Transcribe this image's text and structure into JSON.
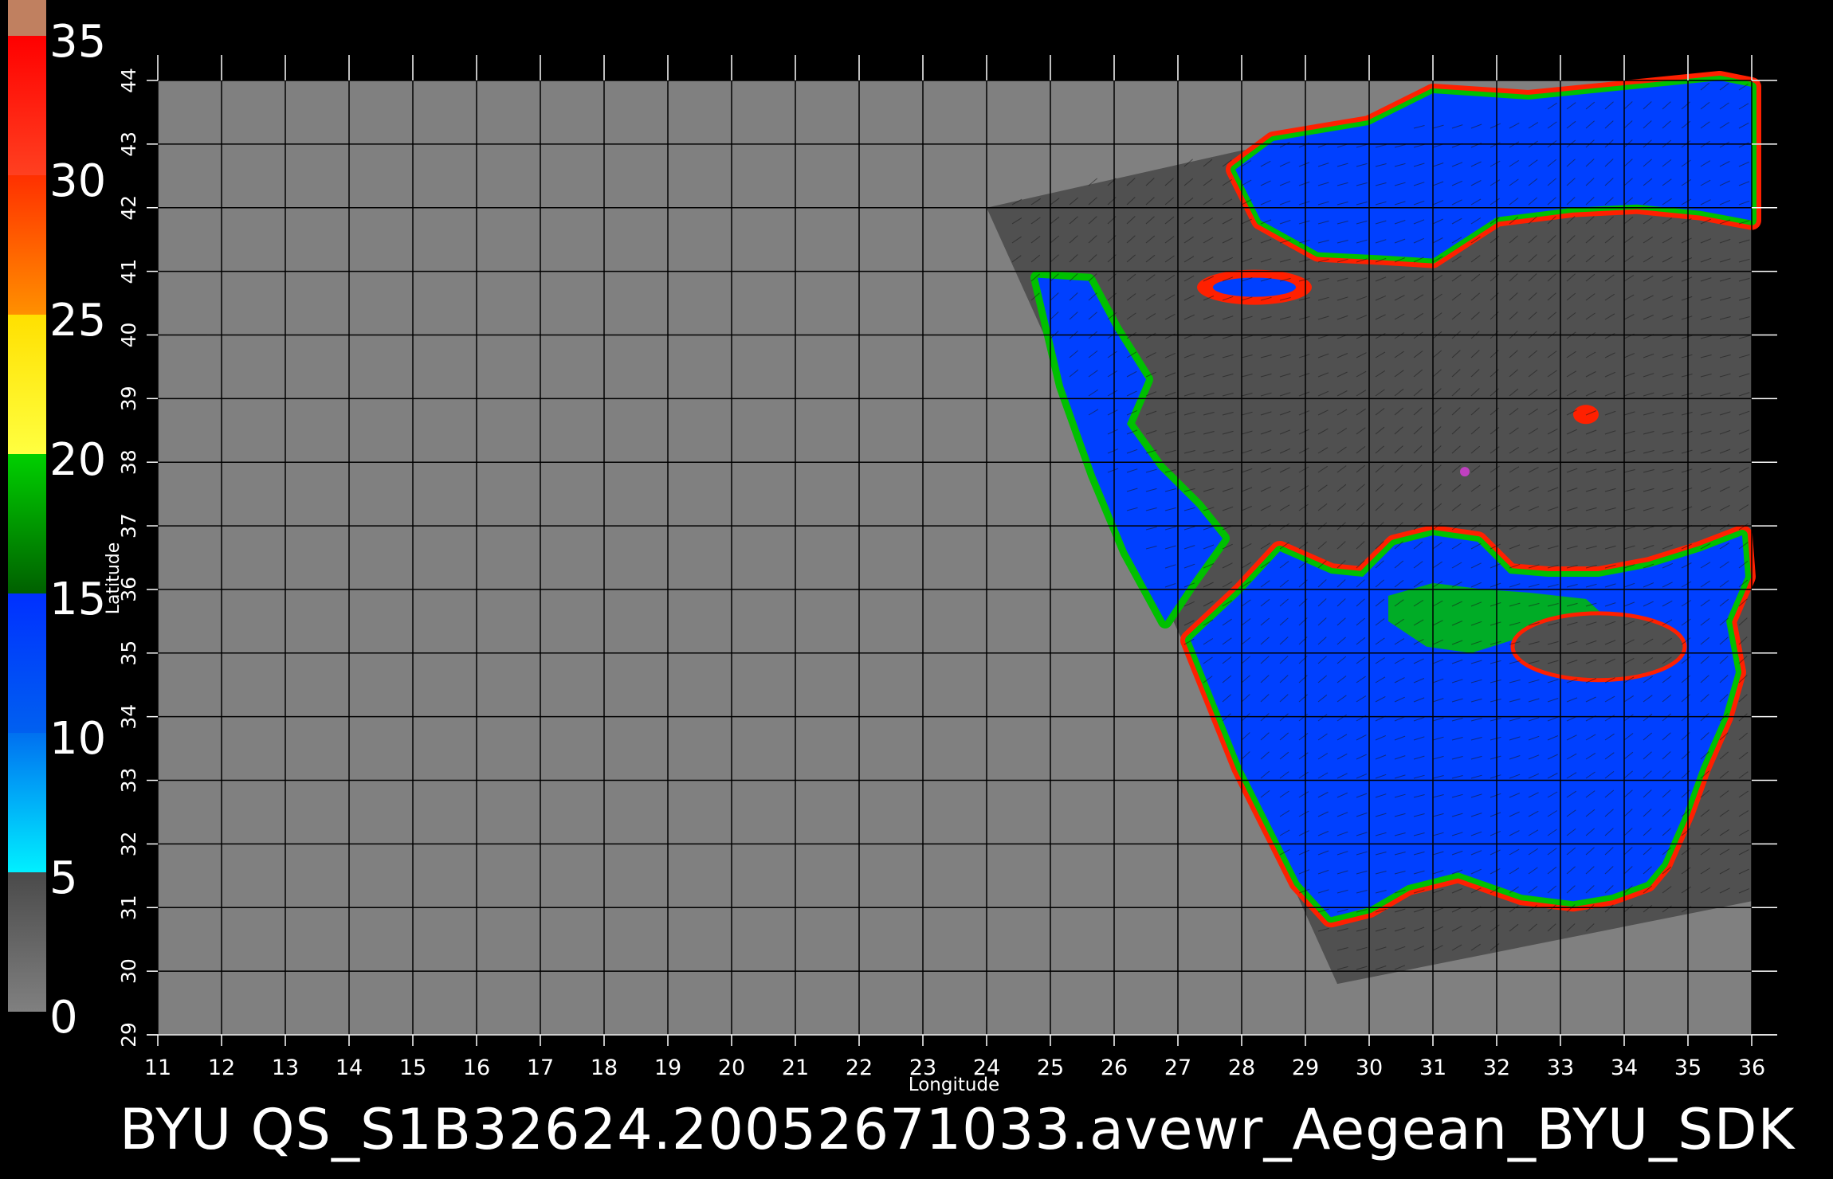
{
  "colorbar": {
    "tick_labels": [
      "0",
      "5",
      "10",
      "15",
      "20",
      "25",
      "30",
      "35"
    ],
    "segments": [
      {
        "from": 0,
        "to": 5,
        "color_top": "#4a4a4a",
        "color_bottom": "#808080"
      },
      {
        "from": 5,
        "to": 10,
        "color_top": "#0070f0",
        "color_bottom": "#00f0ff"
      },
      {
        "from": 10,
        "to": 15,
        "color_top": "#0030ff",
        "color_bottom": "#0060f0"
      },
      {
        "from": 15,
        "to": 20,
        "color_top": "#00d000",
        "color_bottom": "#006000"
      },
      {
        "from": 20,
        "to": 25,
        "color_top": "#ffe000",
        "color_bottom": "#ffff40"
      },
      {
        "from": 25,
        "to": 30,
        "color_top": "#ff3000",
        "color_bottom": "#ff9000"
      },
      {
        "from": 30,
        "to": 35,
        "color_top": "#ff0000",
        "color_bottom": "#ff4020"
      },
      {
        "from": 35,
        "to": 36,
        "color_top": "#c08060",
        "color_bottom": "#c08060"
      }
    ]
  },
  "map": {
    "xlabel": "Longitude",
    "ylabel": "Latitude",
    "lon_ticks": [
      "11",
      "12",
      "13",
      "14",
      "15",
      "16",
      "17",
      "18",
      "19",
      "20",
      "21",
      "22",
      "23",
      "24",
      "25",
      "26",
      "27",
      "28",
      "29",
      "30",
      "31",
      "32",
      "33",
      "34",
      "35",
      "36"
    ],
    "lat_ticks": [
      "29",
      "30",
      "31",
      "32",
      "33",
      "34",
      "35",
      "36",
      "37",
      "38",
      "39",
      "40",
      "41",
      "42",
      "43",
      "44"
    ],
    "lon_range": [
      11,
      36
    ],
    "lat_range": [
      29,
      44
    ],
    "grid": true,
    "colors": {
      "background": "#000000",
      "no_data": "#808080",
      "swath": "#505050",
      "grid": "#000000",
      "low_wind": "#0040ff",
      "mid_wind": "#00c000",
      "high_wind": "#ff2000"
    }
  },
  "caption": "BYU QS_S1B32624.20052671033.avewr_Aegean_BYU_SDK"
}
